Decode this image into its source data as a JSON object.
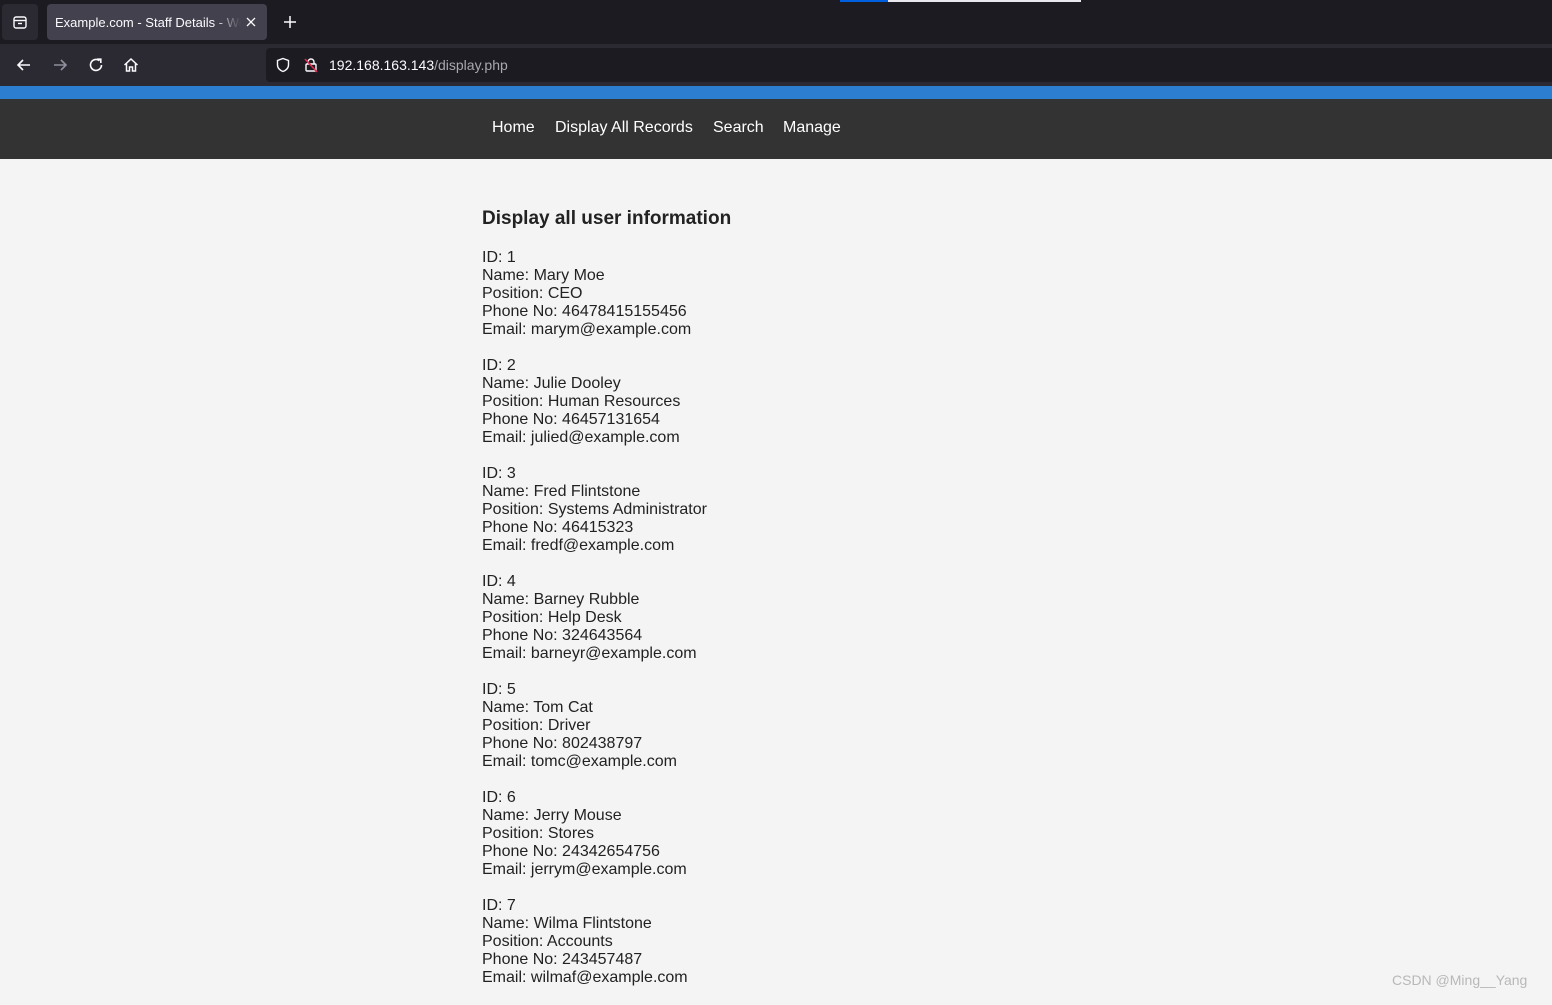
{
  "browser": {
    "tab_title": "Example.com - Staff Details - Welcome",
    "url_host": "192.168.163.143",
    "url_path": "/display.php"
  },
  "nav": {
    "items": [
      "Home",
      "Display All Records",
      "Search",
      "Manage"
    ]
  },
  "content": {
    "heading": "Display all user information",
    "records": [
      {
        "id": "ID: 1",
        "name": "Name: Mary Moe",
        "position": "Position: CEO",
        "phone": "Phone No: 46478415155456",
        "email": "Email: marym@example.com"
      },
      {
        "id": "ID: 2",
        "name": "Name: Julie Dooley",
        "position": "Position: Human Resources",
        "phone": "Phone No: 46457131654",
        "email": "Email: julied@example.com"
      },
      {
        "id": "ID: 3",
        "name": "Name: Fred Flintstone",
        "position": "Position: Systems Administrator",
        "phone": "Phone No: 46415323",
        "email": "Email: fredf@example.com"
      },
      {
        "id": "ID: 4",
        "name": "Name: Barney Rubble",
        "position": "Position: Help Desk",
        "phone": "Phone No: 324643564",
        "email": "Email: barneyr@example.com"
      },
      {
        "id": "ID: 5",
        "name": "Name: Tom Cat",
        "position": "Position: Driver",
        "phone": "Phone No: 802438797",
        "email": "Email: tomc@example.com"
      },
      {
        "id": "ID: 6",
        "name": "Name: Jerry Mouse",
        "position": "Position: Stores",
        "phone": "Phone No: 24342654756",
        "email": "Email: jerrym@example.com"
      },
      {
        "id": "ID: 7",
        "name": "Name: Wilma Flintstone",
        "position": "Position: Accounts",
        "phone": "Phone No: 243457487",
        "email": "Email: wilmaf@example.com"
      }
    ]
  },
  "watermark": "CSDN @Ming__Yang",
  "colors": {
    "accent_bar": "#2c7fd0",
    "site_nav_bg": "#333333",
    "page_bg": "#f4f4f4",
    "browser_bg": "#1c1b22"
  },
  "icons": [
    "tab-overview-icon",
    "close-icon",
    "plus-icon",
    "back-arrow-icon",
    "forward-arrow-icon",
    "reload-icon",
    "home-icon",
    "shield-icon",
    "insecure-lock-icon"
  ]
}
